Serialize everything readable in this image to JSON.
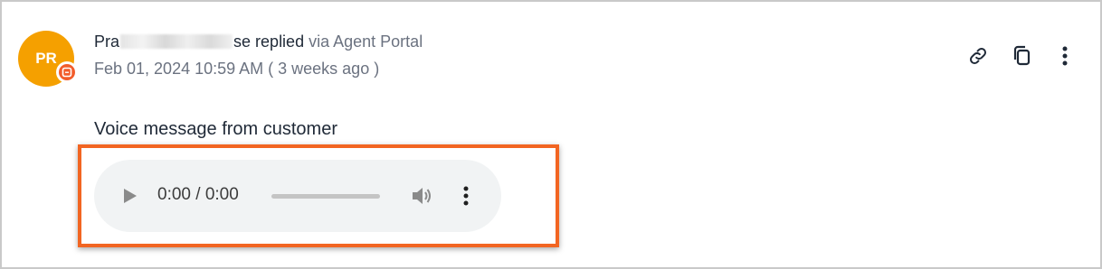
{
  "reply": {
    "avatar_initials": "PR",
    "author_name_start": "Pra",
    "author_name_end": "se",
    "action": "replied",
    "via": "via Agent Portal",
    "timestamp": "Feb 01, 2024 10:59 AM ( 3 weeks ago )",
    "message": "Voice message from customer"
  },
  "audio": {
    "time_text": "0:00 / 0:00",
    "progress_fraction": 0
  },
  "actions": {
    "icons": [
      "link-icon",
      "copy-icon",
      "more-vertical-icon"
    ]
  },
  "colors": {
    "avatar": "#f5a000",
    "badge": "#f25c2b",
    "highlight": "#f26522",
    "player_bg": "#f1f3f4"
  }
}
